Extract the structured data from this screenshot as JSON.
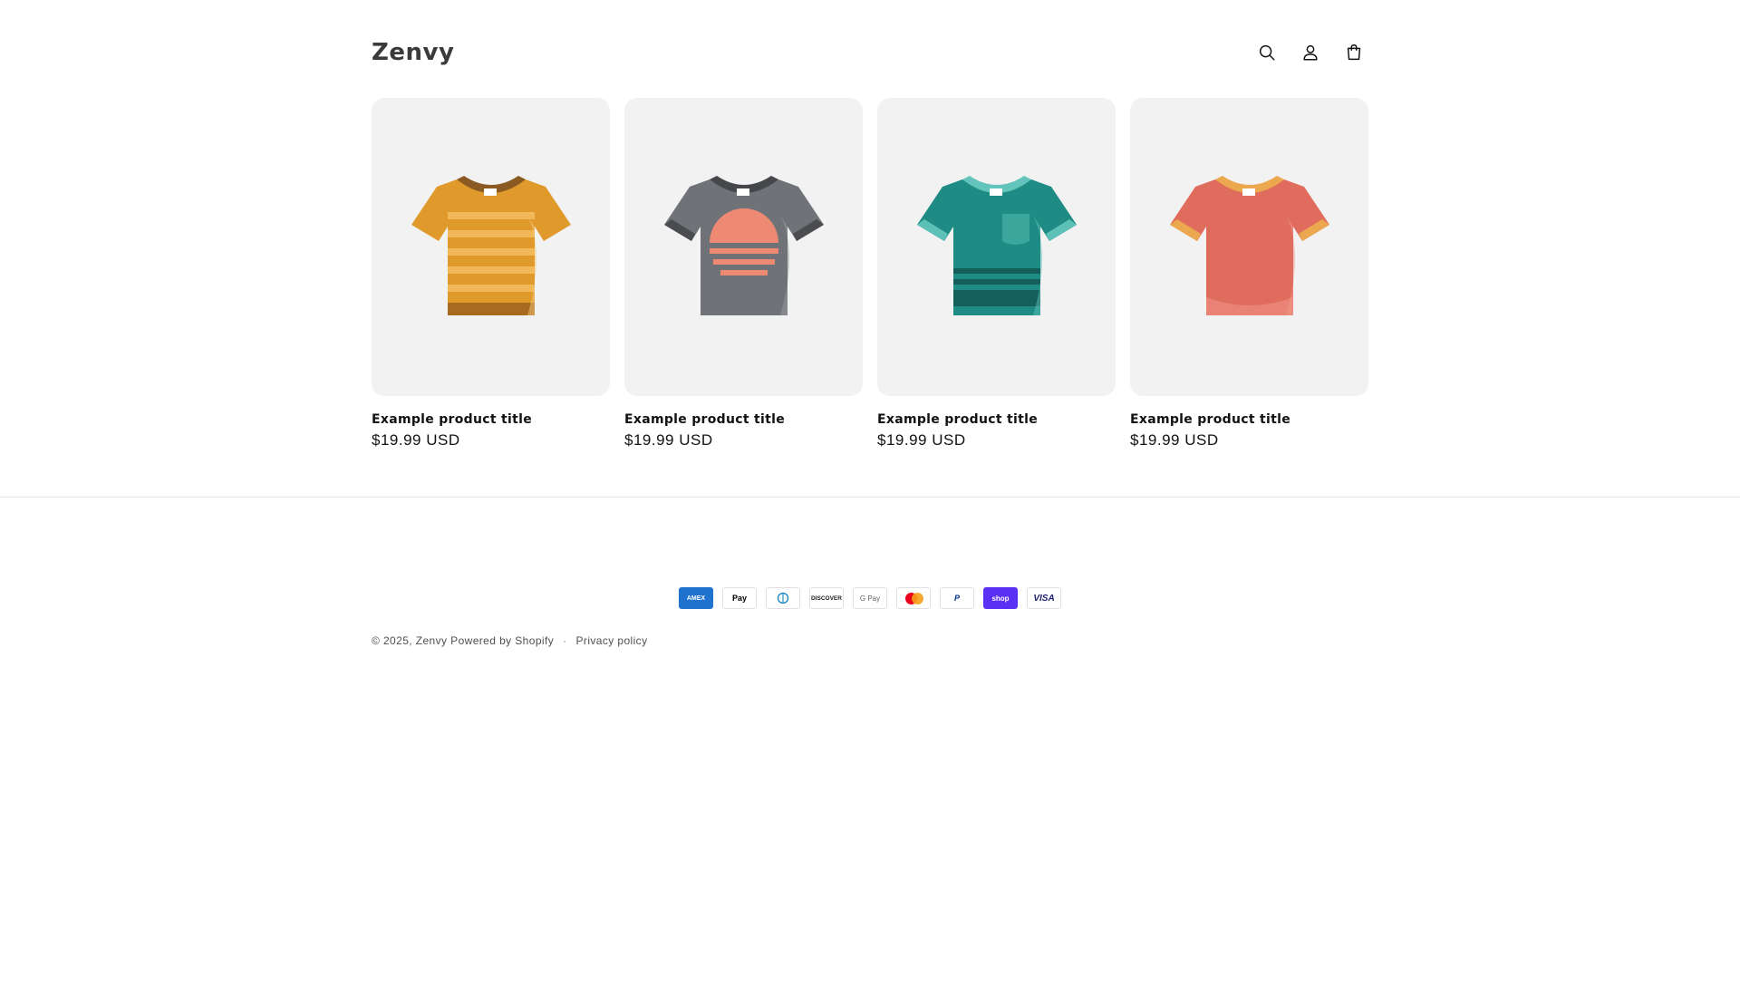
{
  "header": {
    "logo": "Zenvy",
    "icons": [
      "search-icon",
      "account-icon",
      "cart-icon"
    ]
  },
  "products": [
    {
      "title": "Example product title",
      "price": "$19.99 USD",
      "color": "#e09a2c"
    },
    {
      "title": "Example product title",
      "price": "$19.99 USD",
      "color": "#6f7277"
    },
    {
      "title": "Example product title",
      "price": "$19.99 USD",
      "color": "#1e8c84"
    },
    {
      "title": "Example product title",
      "price": "$19.99 USD",
      "color": "#e06c5e"
    }
  ],
  "footer": {
    "payment_methods": [
      "AMEX",
      "Pay",
      "Diners",
      "DISCOVER",
      "G Pay",
      "Mastercard",
      "PayPal",
      "shop",
      "VISA"
    ],
    "copyright": "© 2025,",
    "store_link": "Zenvy",
    "powered_by": "Powered by Shopify",
    "separator": "·",
    "privacy": "Privacy policy"
  }
}
